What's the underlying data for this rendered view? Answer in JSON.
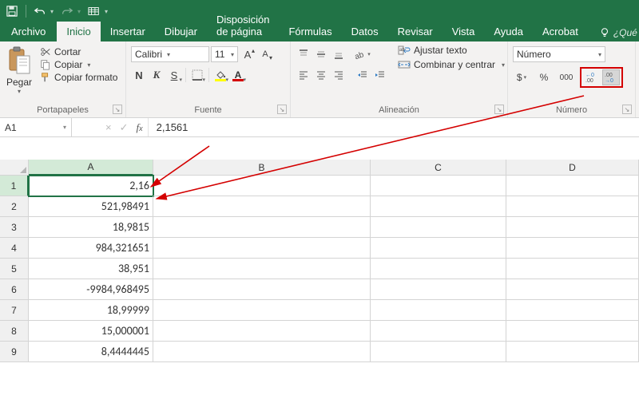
{
  "titlebar": {
    "qat": [
      "save-icon",
      "undo-icon",
      "redo-icon",
      "touch-mode-icon"
    ]
  },
  "tabs": {
    "file": "Archivo",
    "home": "Inicio",
    "insert": "Insertar",
    "draw": "Dibujar",
    "pagelayout": "Disposición de página",
    "formulas": "Fórmulas",
    "data": "Datos",
    "review": "Revisar",
    "view": "Vista",
    "help": "Ayuda",
    "acrobat": "Acrobat",
    "tellme": "¿Qué"
  },
  "ribbon": {
    "clipboard": {
      "paste": "Pegar",
      "cut": "Cortar",
      "copy": "Copiar",
      "formatpainter": "Copiar formato",
      "label": "Portapapeles"
    },
    "font": {
      "name": "Calibri",
      "size": "11",
      "bold": "N",
      "italic": "K",
      "underline": "S",
      "label": "Fuente"
    },
    "alignment": {
      "wrap": "Ajustar texto",
      "merge": "Combinar y centrar",
      "label": "Alineación"
    },
    "number": {
      "format": "Número",
      "currency": "$",
      "percent": "%",
      "thousands": "000",
      "label": "Número"
    }
  },
  "formula_bar": {
    "namebox": "A1",
    "formula": "2,1561"
  },
  "grid": {
    "cols": [
      "A",
      "B",
      "C",
      "D"
    ],
    "rows": [
      "1",
      "2",
      "3",
      "4",
      "5",
      "6",
      "7",
      "8",
      "9"
    ],
    "colA": [
      "2,16",
      "521,98491",
      "18,9815",
      "984,321651",
      "38,951",
      "-9984,968495",
      "18,99999",
      "15,000001",
      "8,4444445"
    ]
  }
}
